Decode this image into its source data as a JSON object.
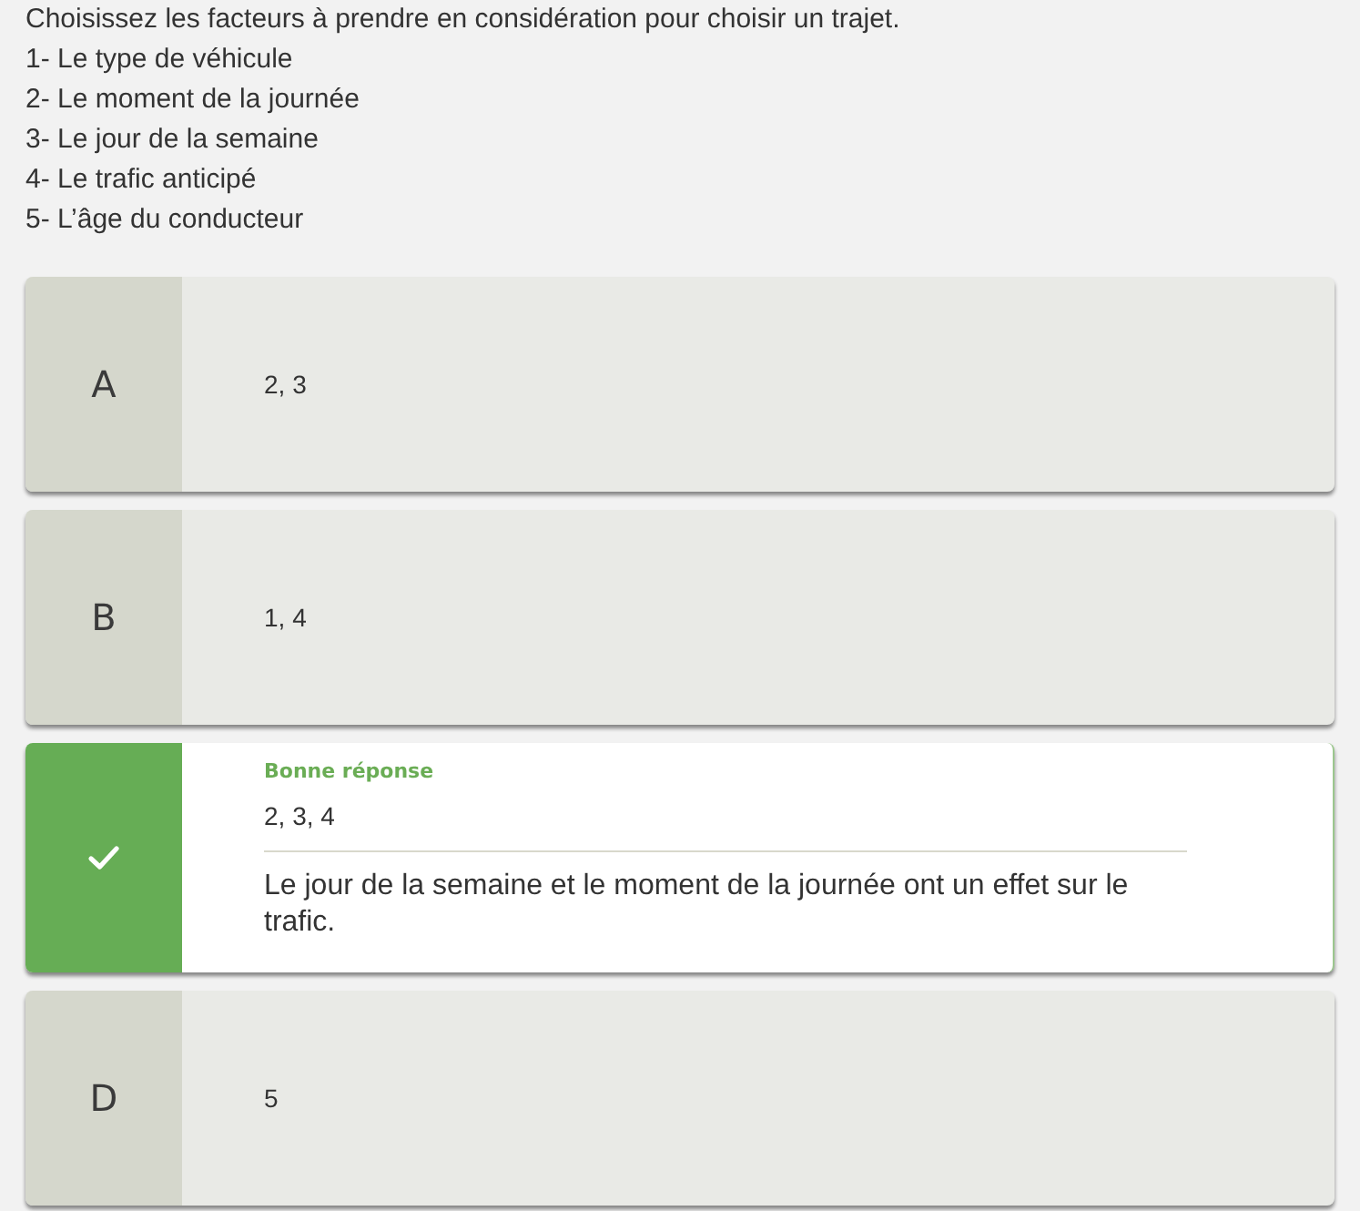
{
  "question": {
    "prompt": "Choisissez les facteurs à prendre en considération pour choisir un trajet.",
    "items": [
      "1- Le type de véhicule",
      "2- Le moment de la journée",
      "3- Le jour de la semaine",
      "4- Le trafic anticipé",
      "5- L’âge du conducteur"
    ]
  },
  "options": [
    {
      "letter": "A",
      "answer": "2, 3",
      "correct": false
    },
    {
      "letter": "B",
      "answer": "1, 4",
      "correct": false
    },
    {
      "answer": "2, 3, 4",
      "correct": true,
      "feedback_label": "Bonne réponse",
      "explanation": "Le jour de la semaine et le moment de la journée ont un effet sur le trafic."
    },
    {
      "letter": "D",
      "answer": "5",
      "correct": false
    }
  ]
}
